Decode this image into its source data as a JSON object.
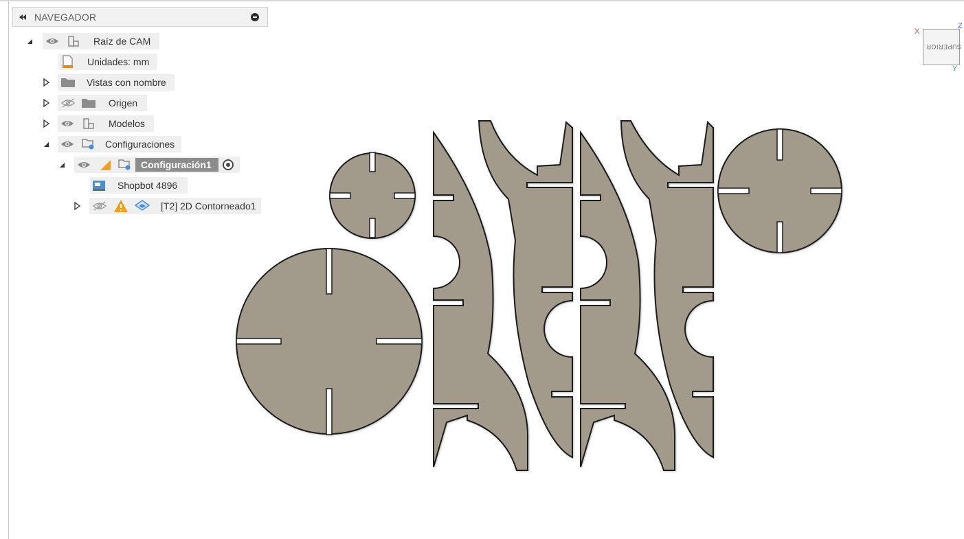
{
  "navigator": {
    "title": "NAVEGADOR",
    "tree": {
      "root": {
        "label": "Raíz de CAM"
      },
      "units": {
        "label": "Unidades: mm"
      },
      "named_views": {
        "label": "Vistas con nombre"
      },
      "origin": {
        "label": "Origen"
      },
      "models": {
        "label": "Modelos"
      },
      "setups": {
        "label": "Configuraciones"
      },
      "setup1": {
        "label": "Configuración1"
      },
      "machine": {
        "label": "Shopbot 4896"
      },
      "operation": {
        "label": "[T2] 2D Contorneado1"
      }
    }
  },
  "viewcube": {
    "face": "SUPERIOR",
    "axes": {
      "x": "X",
      "y": "Y",
      "z": "Z"
    }
  },
  "colors": {
    "part_fill": "#a29b8b",
    "part_stroke": "#1a1a1a",
    "warning": "#f0a020",
    "selected_bg": "#8c8c8c"
  },
  "icons": [
    "collapse-panel-icon",
    "close-panel-icon",
    "eye-icon",
    "eye-hidden-icon",
    "component-icon",
    "document-units-icon",
    "folder-icon",
    "setup-icon",
    "warning-icon",
    "machine-icon",
    "operation-icon",
    "activate-icon"
  ]
}
